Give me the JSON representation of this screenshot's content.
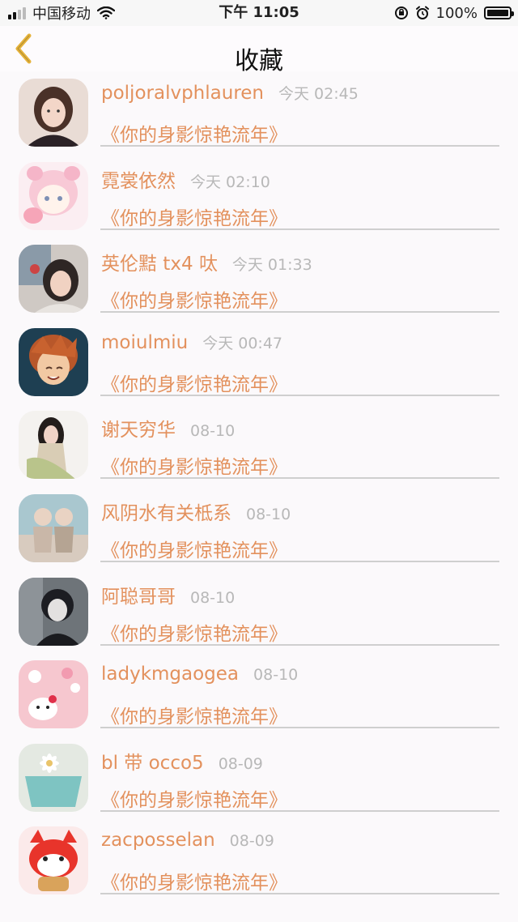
{
  "status_bar": {
    "carrier": "中国移动",
    "time": "下午 11:05",
    "battery": "100%"
  },
  "nav": {
    "title": "收藏",
    "back_icon": "chevron-left-icon"
  },
  "colors": {
    "accent": "#e3915d",
    "back_icon": "#e6b23a",
    "time_text": "#b8b8b8",
    "divider": "#cfcfcf"
  },
  "favorites": [
    {
      "name": "poljoralvphlauren",
      "time": "今天 02:45",
      "song": "《你的身影惊艳流年》",
      "avatar": "girl-photo-avatar"
    },
    {
      "name": "霓裳依然",
      "time": "今天 02:10",
      "song": "《你的身影惊艳流年》",
      "avatar": "pink-cartoon-avatar"
    },
    {
      "name": "英伦黠 tx4 呔",
      "time": "今天 01:33",
      "song": "《你的身影惊艳流年》",
      "avatar": "girl-photo-avatar"
    },
    {
      "name": "moiulmiu",
      "time": "今天 00:47",
      "song": "《你的身影惊艳流年》",
      "avatar": "anime-boy-avatar"
    },
    {
      "name": "谢天穷华",
      "time": "08-10",
      "song": "《你的身影惊艳流年》",
      "avatar": "girl-photo-avatar"
    },
    {
      "name": "风阴水有关柢系",
      "time": "08-10",
      "song": "《你的身影惊艳流年》",
      "avatar": "two-kids-avatar"
    },
    {
      "name": "阿聪哥哥",
      "time": "08-10",
      "song": "《你的身影惊艳流年》",
      "avatar": "anime-boy-avatar"
    },
    {
      "name": "ladykmgaogea",
      "time": "08-10",
      "song": "《你的身影惊艳流年》",
      "avatar": "hello-kitty-case-avatar"
    },
    {
      "name": "bl 带 occo5",
      "time": "08-09",
      "song": "《你的身影惊艳流年》",
      "avatar": "daisy-cup-avatar"
    },
    {
      "name": "zacposselan",
      "time": "08-09",
      "song": "《你的身影惊艳流年》",
      "avatar": "red-fox-cartoon-avatar"
    }
  ]
}
